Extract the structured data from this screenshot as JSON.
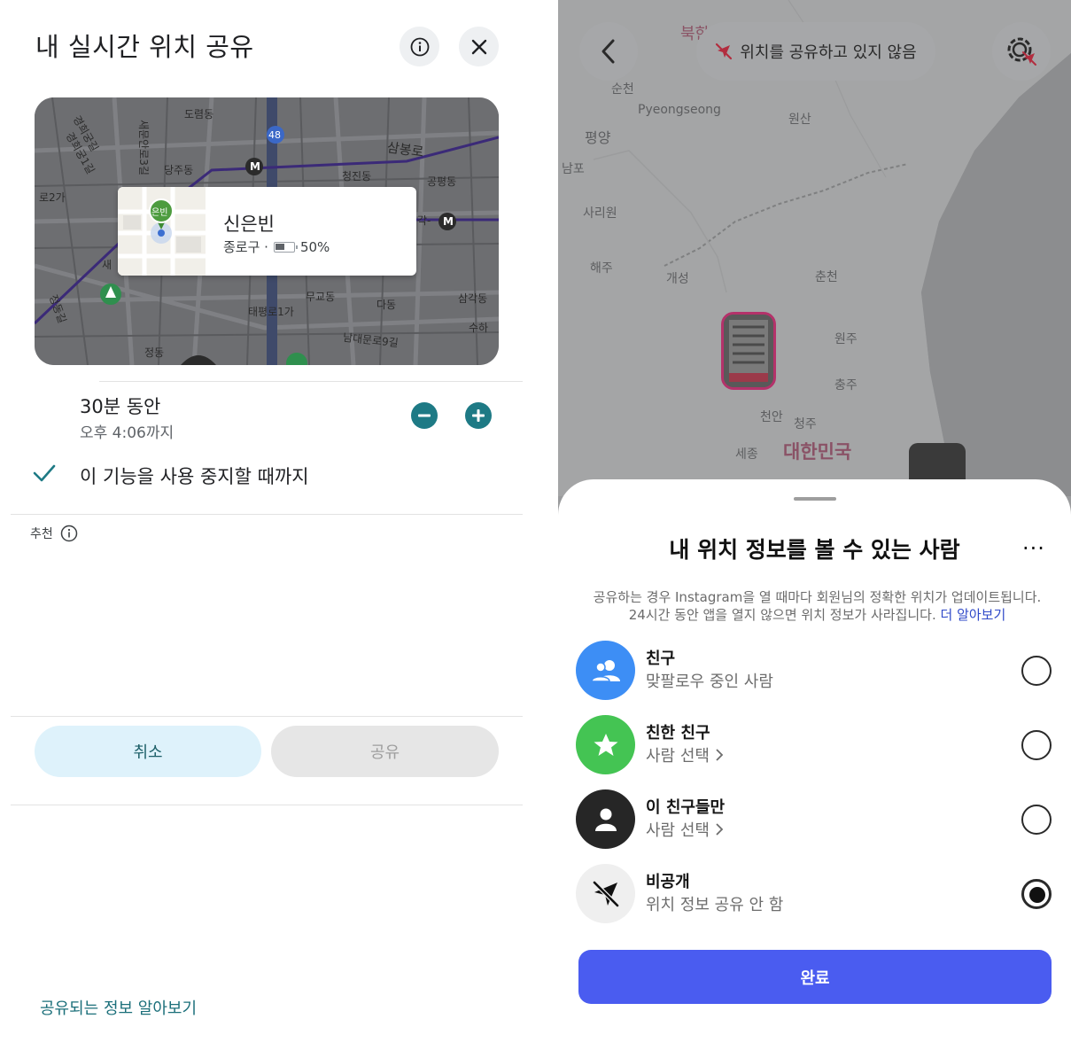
{
  "left": {
    "title": "내 실시간 위치 공유",
    "icons": {
      "info": "info-icon",
      "close": "close-icon"
    },
    "map": {
      "labels": {
        "dorimdong": "도렴동",
        "gyeonghuigung": "경희궁길",
        "gyeonghuigung1": "경희궁1길",
        "sejong3": "새문안로3길",
        "danjudong": "당주동",
        "sambongro": "삼봉로",
        "cheongjindong": "청진동",
        "gongpyeongdong": "공평동",
        "ro2ga": "로2가",
        "ro1ga": "각-",
        "mugyodong": "무교동",
        "dadong": "다동",
        "samgakdong": "삼각동",
        "taepyeongro": "태평로1가",
        "suha": "수하",
        "namdaemun": "남대문로9길",
        "jeongdong": "정동",
        "jeongdonggil": "정동길",
        "route48": "48",
        "sae": "새"
      },
      "metro_symbol": "M",
      "pin_label": "은빈"
    },
    "popup": {
      "name": "신은빈",
      "district": "종로구 ·",
      "battery": "50%",
      "battery_level": 0.5
    },
    "duration": {
      "main": "30분 동안",
      "until_time": "오후 4:06까지"
    },
    "until_option": "이 기능을 사용 중지할 때까지",
    "recommend_label": "추천",
    "cancel_label": "취소",
    "share_label": "공유",
    "learn_link": "공유되는 정보 알아보기",
    "accent_color": "#1e7a85"
  },
  "right": {
    "top": {
      "status_text": "위치를 공유하고 있지 않음",
      "back_icon": "chevron-left-icon",
      "settings_icon": "gear-location-off-icon"
    },
    "map_labels": {
      "north": "북한",
      "suncheon": "순천",
      "pyeongseong": "Pyeongseong",
      "pyongyang": "평양",
      "wonsan": "원산",
      "nampo": "남포",
      "sariwon": "사리원",
      "haeju": "해주",
      "kaesong": "개성",
      "chuncheon": "춘천",
      "wonju": "원주",
      "chungju": "충주",
      "cheonan": "천안",
      "cheongju": "청주",
      "sejong": "세종",
      "korea": "대한민국"
    },
    "sheet": {
      "title": "내 위치 정보를 볼 수 있는 사람",
      "more": "···",
      "desc_line1": "공유하는 경우 Instagram을 열 때마다 회원님의 정확한 위치가 업데이트됩니다.",
      "desc_line2": "24시간 동안 앱을 열지 않으면 위치 정보가 사라집니다.",
      "desc_link": "더 알아보기",
      "options": [
        {
          "title": "친구",
          "subtitle": "맞팔로우 중인 사람",
          "icon": "people-icon",
          "color": "#3d8ef5",
          "selected": false
        },
        {
          "title": "친한 친구",
          "subtitle": "사람 선택",
          "icon": "star-icon",
          "color": "#44c453",
          "selected": false
        },
        {
          "title": "이 친구들만",
          "subtitle": "사람 선택",
          "icon": "person-icon",
          "color": "#262626",
          "selected": false
        },
        {
          "title": "비공개",
          "subtitle": "위치 정보 공유 안 함",
          "icon": "location-off-icon",
          "color": "#efefef",
          "selected": true
        }
      ],
      "done_label": "완료",
      "done_color": "#4a5cf0"
    }
  }
}
